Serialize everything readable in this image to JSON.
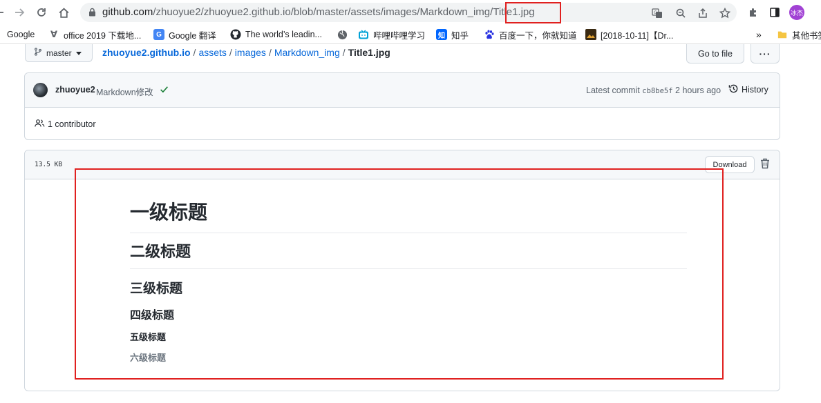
{
  "browser": {
    "url_host": "github.com",
    "url_path": "/zhuoyue2/zhuoyue2.github.io/blob/master/assets/images/Markdown_img/Title1.jpg",
    "avatar_text": "冰杰",
    "bookmarks": [
      {
        "label": "Google",
        "icon": "google-icon"
      },
      {
        "label": "office 2019 下载地...",
        "icon": "office-icon"
      },
      {
        "label": "Google 翻译",
        "icon": "translate-icon"
      },
      {
        "label": "The world’s leadin...",
        "icon": "github-icon"
      },
      {
        "label": "哔哩哔哩学习",
        "icon": "bilibili-icon"
      },
      {
        "label": "知乎",
        "icon": "zhihu-icon"
      },
      {
        "label": "百度一下，你就知道",
        "icon": "baidu-icon"
      },
      {
        "label": "[2018-10-11]【Dr...",
        "icon": "image-icon"
      }
    ],
    "overflow_label": "»",
    "other_bookmarks": "其他书签",
    "accent_colors": {
      "highlight": "#e0201f",
      "link": "#0969da",
      "avatar": "#a142d4"
    }
  },
  "repo": {
    "branch": "master",
    "breadcrumbs": [
      "zhuoyue2.github.io",
      "assets",
      "images",
      "Markdown_img"
    ],
    "file_name": "Title1.jpg",
    "go_to_file": "Go to file",
    "more": "···"
  },
  "commit": {
    "user": "zhuoyue2",
    "message": "Markdown修改",
    "latest_prefix": "Latest commit",
    "sha": "cb8be5f",
    "time": "2 hours ago",
    "history": "History",
    "contributors": "1 contributor"
  },
  "file": {
    "size": "13.5 KB",
    "download": "Download"
  },
  "preview": {
    "h1": "一级标题",
    "h2": "二级标题",
    "h3": "三级标题",
    "h4": "四级标题",
    "h5": "五级标题",
    "h6": "六级标题"
  }
}
